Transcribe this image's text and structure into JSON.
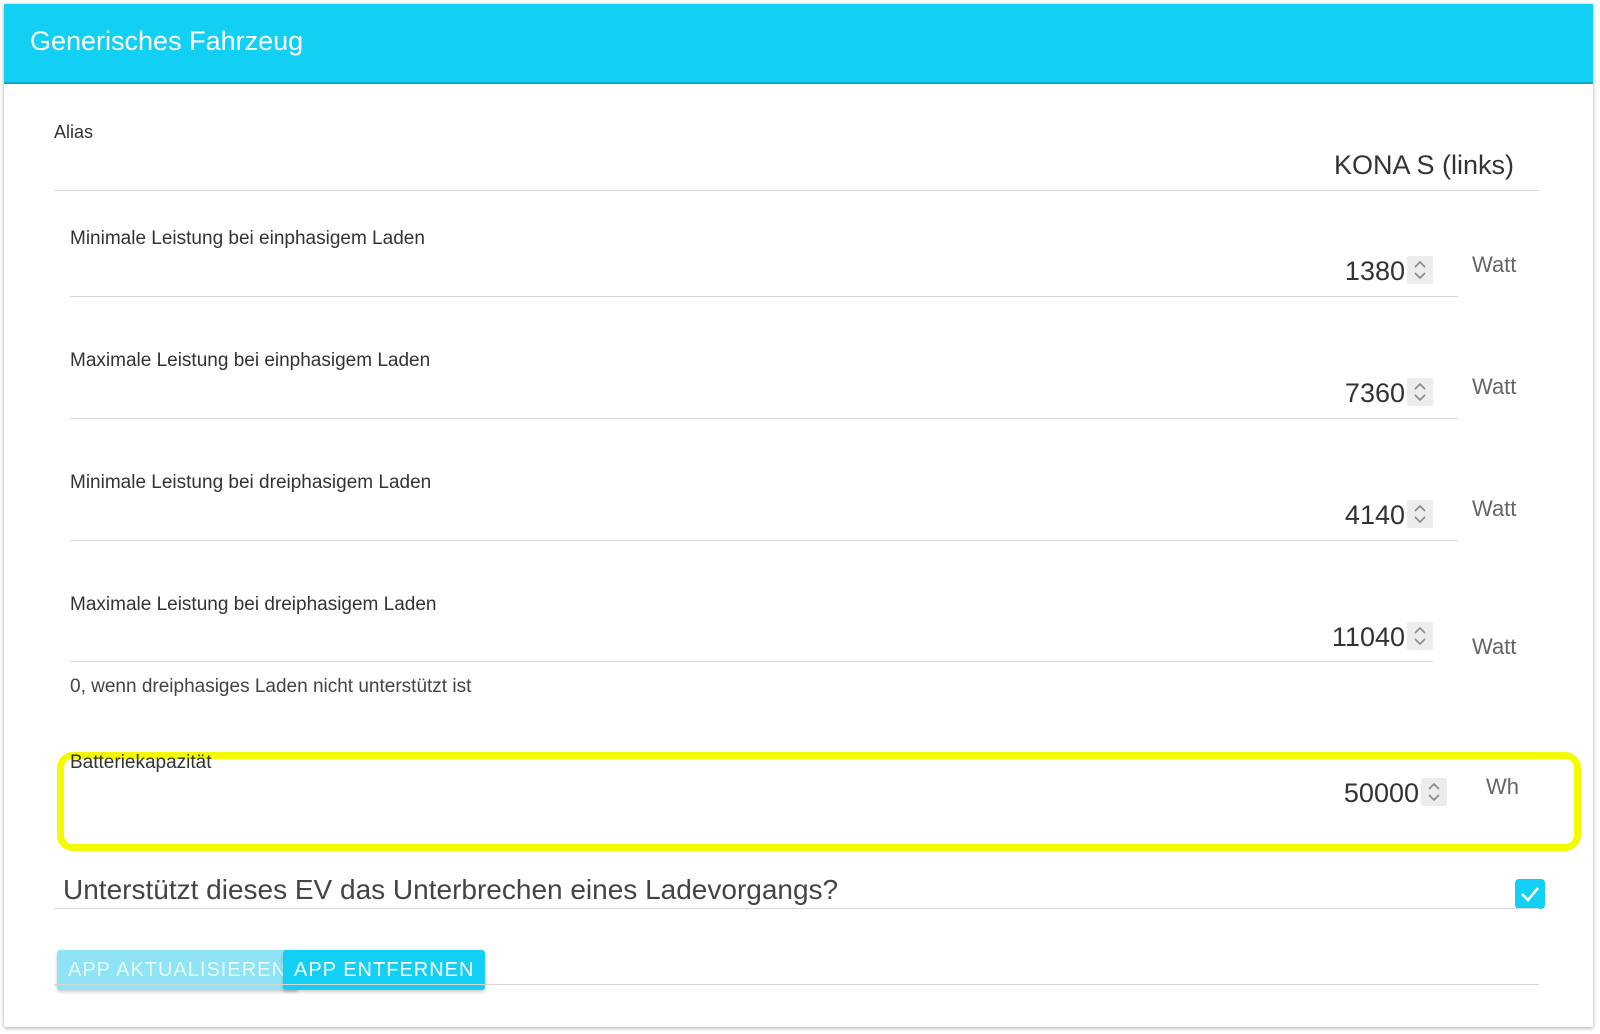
{
  "header": {
    "title": "Generisches Fahrzeug"
  },
  "alias": {
    "label": "Alias",
    "value": "KONA S (links)"
  },
  "fields": [
    {
      "label": "Minimale Leistung bei einphasigem Laden",
      "value": "1380",
      "unit": "Watt"
    },
    {
      "label": "Maximale Leistung bei einphasigem Laden",
      "value": "7360",
      "unit": "Watt"
    },
    {
      "label": "Minimale Leistung bei dreiphasigem Laden",
      "value": "4140",
      "unit": "Watt"
    },
    {
      "label": "Maximale Leistung bei dreiphasigem Laden",
      "value": "11040",
      "unit": "Watt",
      "hint": "0, wenn dreiphasiges Laden nicht unterstützt ist"
    }
  ],
  "battery": {
    "label": "Batteriekapazität",
    "value": "50000",
    "unit": "Wh"
  },
  "interrupt": {
    "question": "Unterstützt dieses EV das Unterbrechen eines Ladevorgangs?",
    "checked": true
  },
  "buttons": {
    "update": "APP AKTUALISIEREN",
    "remove": "APP ENTFERNEN"
  },
  "colors": {
    "accent": "#12cff4",
    "highlight": "#f2fb00"
  },
  "icons": {
    "spinner": "up-down-chevron-icon",
    "checkbox": "checkmark-icon"
  }
}
